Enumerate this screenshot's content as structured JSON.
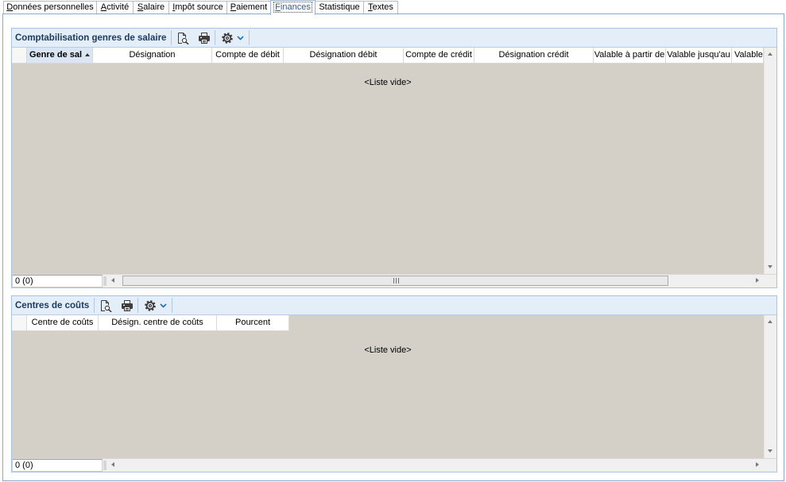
{
  "tabs": [
    {
      "label": "Données personnelles"
    },
    {
      "label": "Activité"
    },
    {
      "label": "Salaire"
    },
    {
      "label": "Impôt source"
    },
    {
      "label": "Paiement"
    },
    {
      "label": "Finances",
      "selected": true
    },
    {
      "label": "Statistique"
    },
    {
      "label": "Textes"
    }
  ],
  "salary_accounting": {
    "title": "Comptabilisation genres de salaire",
    "toolbar": {
      "preview_icon": "print-preview-icon",
      "print_icon": "printer-icon",
      "settings_icon": "gear-icon",
      "settings_dropdown_icon": "chevron-down-icon"
    },
    "columns": [
      {
        "label": "Genre de sal",
        "sort": "ascending"
      },
      {
        "label": "Désignation"
      },
      {
        "label": "Compte de débit"
      },
      {
        "label": "Désignation débit"
      },
      {
        "label": "Compte de crédit"
      },
      {
        "label": "Désignation crédit"
      },
      {
        "label": "Valable à partir de"
      },
      {
        "label": "Valable jusqu'au"
      },
      {
        "label": "Valable"
      }
    ],
    "empty_text": "<Liste vide>",
    "record_count": "0 (0)"
  },
  "cost_centers": {
    "title": "Centres de coûts",
    "toolbar": {
      "preview_icon": "print-preview-icon",
      "print_icon": "printer-icon",
      "settings_icon": "gear-icon",
      "settings_dropdown_icon": "chevron-down-icon"
    },
    "columns": [
      {
        "label": "Centre de coûts"
      },
      {
        "label": "Désign. centre de coûts"
      },
      {
        "label": "Pourcent"
      }
    ],
    "empty_text": "<Liste vide>",
    "record_count": "0 (0)"
  },
  "colors": {
    "group_title": "#1d3a60",
    "group_header_background": "#e4eef9",
    "group_border": "#a8c4e3",
    "list_background": "#d4d0c8",
    "sorted_column_background": "#dae6f3",
    "panel_border": "#89a8cb",
    "dropdown_accent": "#1f6fc0"
  }
}
